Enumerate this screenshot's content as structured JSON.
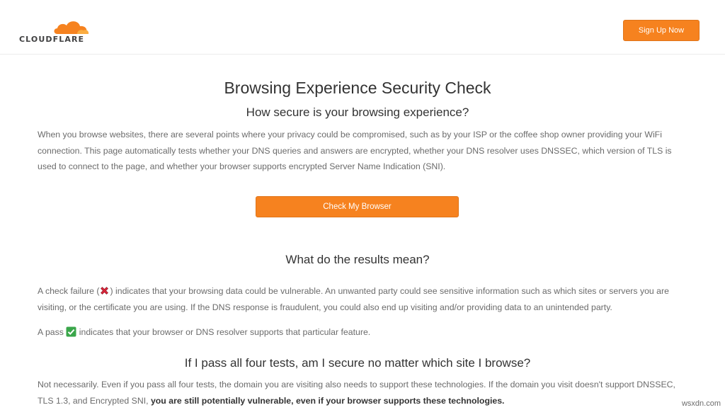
{
  "header": {
    "logo_text": "CLOUDFLARE",
    "signup_label": "Sign Up Now"
  },
  "main": {
    "title": "Browsing Experience Security Check",
    "subtitle": "How secure is your browsing experience?",
    "intro": "When you browse websites, there are several points where your privacy could be compromised, such as by your ISP or the coffee shop owner providing your WiFi connection. This page automatically tests whether your DNS queries and answers are encrypted, whether your DNS resolver uses DNSSEC, which version of TLS is used to connect to the page, and whether your browser supports encrypted Server Name Indication (SNI).",
    "check_button_label": "Check My Browser"
  },
  "results": {
    "heading": "What do the results mean?",
    "failure_prefix": "A check failure (",
    "failure_suffix": ") indicates that your browsing data could be vulnerable. An unwanted party could see sensitive information such as which sites or servers you are visiting, or the certificate you are using. If the DNS response is fraudulent, you could also end up visiting and/or providing data to an unintended party.",
    "pass_prefix": "A pass ",
    "pass_suffix": " indicates that your browser or DNS resolver supports that particular feature."
  },
  "faq": {
    "heading": "If I pass all four tests, am I secure no matter which site I browse?",
    "answer_plain": "Not necessarily. Even if you pass all four tests, the domain you are visiting also needs to support these technologies. If the domain you visit doesn't support DNSSEC, TLS 1.3, and Encrypted SNI, ",
    "answer_bold": "you are still potentially vulnerable, even if your browser supports these technologies."
  },
  "watermark": "wsxdn.com",
  "colors": {
    "accent": "#f6821f",
    "fail_icon": "#d9263a",
    "pass_icon": "#3aa64a"
  },
  "icons": {
    "fail": "cross-mark-icon",
    "pass": "check-mark-icon",
    "logo": "cloudflare-cloud-icon"
  }
}
